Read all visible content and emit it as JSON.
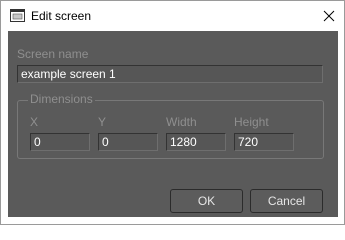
{
  "window": {
    "title": "Edit screen",
    "icon": "edit-window-icon",
    "close_icon": "close-icon"
  },
  "form": {
    "screen_name_label": "Screen name",
    "screen_name_value": "example screen 1",
    "dimensions_title": "Dimensions",
    "x_label": "X",
    "x_value": "0",
    "y_label": "Y",
    "y_value": "0",
    "width_label": "Width",
    "width_value": "1280",
    "height_label": "Height",
    "height_value": "720"
  },
  "buttons": {
    "ok_label": "OK",
    "cancel_label": "Cancel"
  },
  "colors": {
    "panel_background": "#5a5a5a",
    "field_background": "#565656",
    "label_text": "#8f8f8f",
    "field_text": "#ffffff"
  }
}
